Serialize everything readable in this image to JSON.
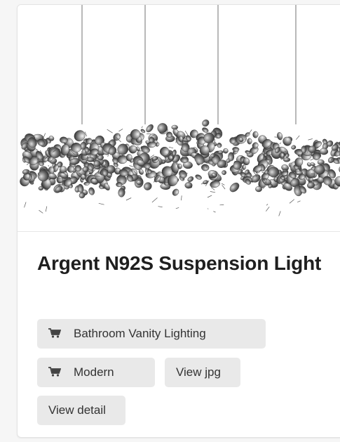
{
  "product": {
    "title": "Argent N92S Suspension Light",
    "image_alt": "Argent N92S Suspension Light - chrome leaf chandelier"
  },
  "tags": {
    "category_label": "Bathroom Vanity Lighting",
    "style_label": "Modern"
  },
  "actions": {
    "view_jpg_label": "View jpg",
    "view_detail_label": "View detail"
  },
  "icons": {
    "tag_icon": "cart-icon"
  },
  "colors": {
    "card_bg": "#ffffff",
    "button_bg": "#e9e9e9",
    "title_text": "#1f1f1f"
  }
}
